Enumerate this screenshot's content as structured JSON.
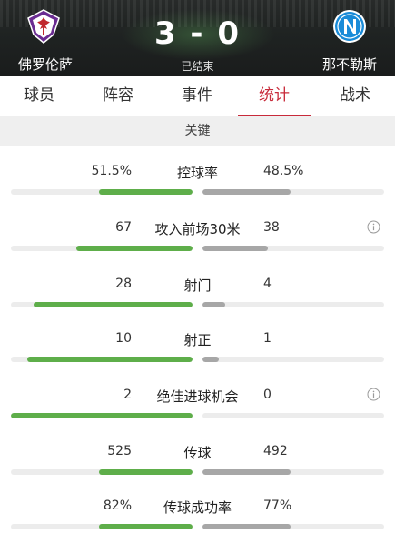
{
  "header": {
    "home_team": "佛罗伦萨",
    "away_team": "那不勒斯",
    "score": "3 - 0",
    "status": "已结束",
    "home_logo_icon": "fiorentina-crest-icon",
    "away_logo_icon": "napoli-crest-icon"
  },
  "tabs": [
    {
      "label": "球员",
      "active": false
    },
    {
      "label": "阵容",
      "active": false
    },
    {
      "label": "事件",
      "active": false
    },
    {
      "label": "统计",
      "active": true
    },
    {
      "label": "战术",
      "active": false
    }
  ],
  "section": {
    "title": "关键"
  },
  "colors": {
    "accent": "#c82a3a",
    "home_bar": "#5eae4a",
    "away_bar": "#a7a7a7"
  },
  "stats": [
    {
      "label": "控球率",
      "home": "51.5%",
      "away": "48.5%",
      "home_fraction": 0.515,
      "away_fraction": 0.485,
      "info": false
    },
    {
      "label": "攻入前场30米",
      "home": "67",
      "away": "38",
      "home_fraction": 0.638,
      "away_fraction": 0.362,
      "info": true
    },
    {
      "label": "射门",
      "home": "28",
      "away": "4",
      "home_fraction": 0.875,
      "away_fraction": 0.125,
      "info": false
    },
    {
      "label": "射正",
      "home": "10",
      "away": "1",
      "home_fraction": 0.909,
      "away_fraction": 0.091,
      "info": false
    },
    {
      "label": "绝佳进球机会",
      "home": "2",
      "away": "0",
      "home_fraction": 1.0,
      "away_fraction": 0.0,
      "info": true
    },
    {
      "label": "传球",
      "home": "525",
      "away": "492",
      "home_fraction": 0.516,
      "away_fraction": 0.484,
      "info": false
    },
    {
      "label": "传球成功率",
      "home": "82%",
      "away": "77%",
      "home_fraction": 0.516,
      "away_fraction": 0.484,
      "info": false
    }
  ]
}
